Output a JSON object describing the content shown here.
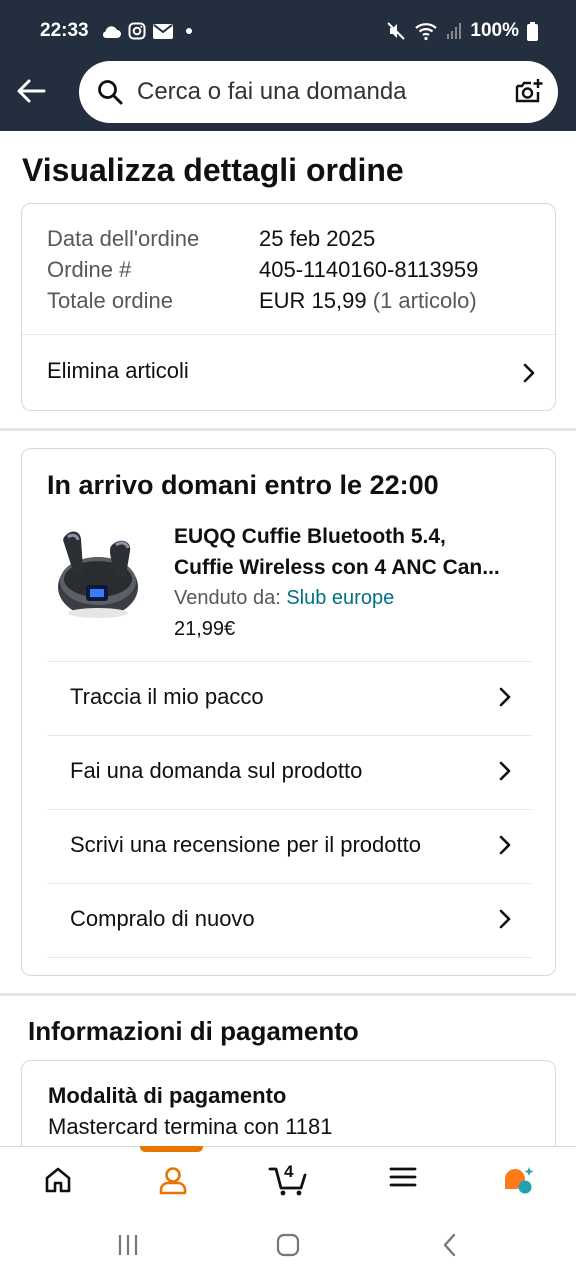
{
  "status_bar": {
    "time": "22:33",
    "battery": "100%",
    "left_icons": [
      "cloud-icon",
      "instagram-icon",
      "mail-icon",
      "dot-icon"
    ],
    "right_icons": [
      "mute-icon",
      "wifi-icon",
      "signal-icon",
      "battery-icon"
    ]
  },
  "header": {
    "search_placeholder": "Cerca o fai una domanda",
    "icons": [
      "back-arrow-icon",
      "search-icon",
      "camera-icon"
    ]
  },
  "page": {
    "title": "Visualizza dettagli ordine"
  },
  "order_summary": {
    "date_label": "Data dell'ordine",
    "date_value": "25 feb 2025",
    "number_label": "Ordine #",
    "number_value": "405-1140160-8113959",
    "total_label": "Totale ordine",
    "total_value": "EUR 15,99",
    "total_items": "(1 articolo)",
    "delete_items": "Elimina articoli"
  },
  "shipment": {
    "title": "In arrivo domani entro le 22:00",
    "product": {
      "name_line1": "EUQQ Cuffie Bluetooth 5.4,",
      "name_line2": "Cuffie Wireless con 4 ANC Can...",
      "sold_by_label": "Venduto da:",
      "seller": "Slub europe",
      "price": "21,99€"
    },
    "actions": [
      {
        "label": "Traccia il mio pacco"
      },
      {
        "label": "Fai una domanda sul prodotto"
      },
      {
        "label": "Scrivi una recensione per il prodotto"
      },
      {
        "label": "Compralo di nuovo"
      }
    ]
  },
  "payment": {
    "title": "Informazioni di pagamento",
    "method_label": "Modalità di pagamento",
    "method_value": "Mastercard termina con 1181"
  },
  "bottom_nav": {
    "items": [
      "home-icon",
      "account-icon",
      "cart-icon",
      "menu-icon",
      "rufus-icon"
    ],
    "active": "account-icon",
    "cart_count": "4"
  },
  "colors": {
    "header_bg": "#232f3e",
    "accent": "#e77600",
    "link": "#007185",
    "rufus": "#ff7a1a"
  }
}
